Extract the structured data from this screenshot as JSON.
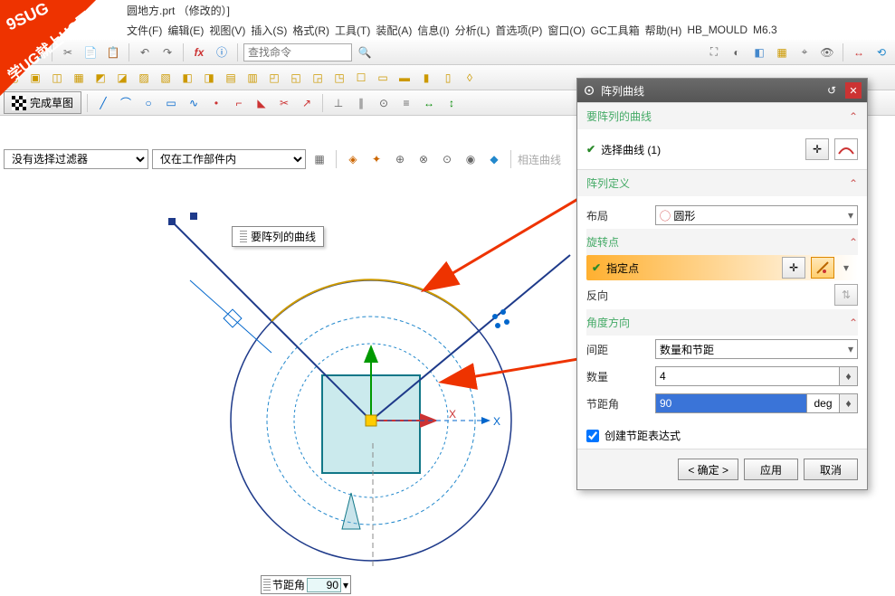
{
  "watermark": {
    "line1": "9SUG",
    "line2": "学UG就上UG网"
  },
  "title": "圆地方.prt （修改的）]",
  "menu": {
    "file": "文件(F)",
    "edit": "编辑(E)",
    "view": "视图(V)",
    "insert": "插入(S)",
    "format": "格式(R)",
    "tools": "工具(T)",
    "assembly": "装配(A)",
    "info": "信息(I)",
    "analysis": "分析(L)",
    "prefs": "首选项(P)",
    "window": "窗口(O)",
    "gctoolbox": "GC工具箱",
    "help": "帮助(H)",
    "hbmould": "HB_MOULD",
    "m63": "M6.3"
  },
  "toolbar": {
    "search_placeholder": "查找命令",
    "related_curve": "相连曲线"
  },
  "sketch": {
    "finish": "完成草图"
  },
  "filter": {
    "no_filter": "没有选择过滤器",
    "in_part": "仅在工作部件内"
  },
  "canvas": {
    "pattern_label": "要阵列的曲线",
    "x_axis": "X",
    "angle_label": "节距角",
    "angle_value": "90"
  },
  "dialog": {
    "title": "阵列曲线",
    "section_curves": "要阵列的曲线",
    "select_curve": "选择曲线 (1)",
    "section_def": "阵列定义",
    "layout_label": "布局",
    "layout_value": "圆形",
    "rotate_point": "旋转点",
    "specify_point": "指定点",
    "reverse": "反向",
    "angle_dir": "角度方向",
    "spacing_label": "间距",
    "spacing_value": "数量和节距",
    "count_label": "数量",
    "count_value": "4",
    "pitch_label": "节距角",
    "pitch_value": "90",
    "pitch_unit": "deg",
    "create_expr": "创建节距表达式",
    "ok": "< 确定 >",
    "apply": "应用",
    "cancel": "取消"
  }
}
